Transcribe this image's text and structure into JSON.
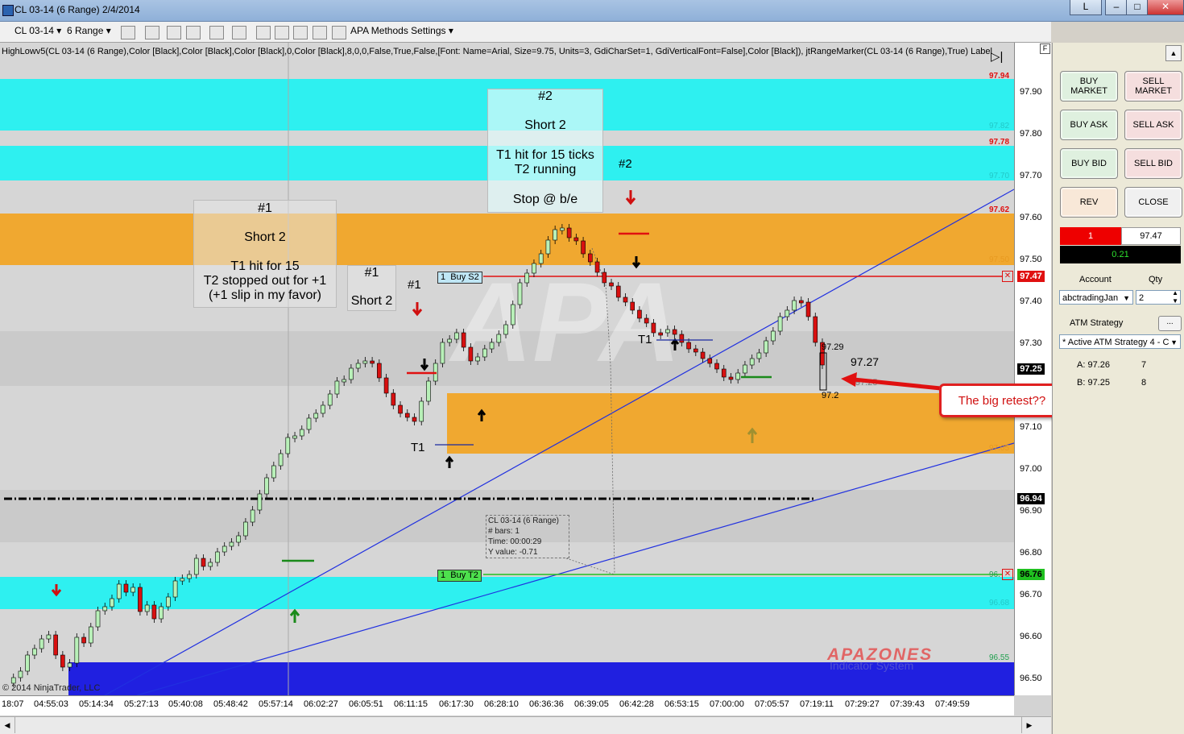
{
  "window": {
    "title": "CL 03-14 (6 Range)  2/4/2014",
    "btn_l": "L"
  },
  "toolbar": {
    "instrument": "CL 03-14",
    "period": "6 Range",
    "apa_settings": "APA Methods Settings"
  },
  "chart": {
    "indicator_text": "HighLowv5(CL 03-14 (6 Range),Color [Black],Color [Black],Color [Black],0,Color [Black],8,0,0,False,True,False,[Font: Name=Arial, Size=9.75, Units=3, GdiCharSet=1, GdiVerticalFont=False],Color [Black]), jtRangeMarker(CL 03-14 (6 Range),True) Label",
    "f_button": "F",
    "copyright": "© 2014 NinjaTrader, LLC",
    "watermark_brand": "APAZONES",
    "watermark_sub": "Indicator System",
    "y_ticks": [
      "97.90",
      "97.80",
      "97.70",
      "97.60",
      "97.50",
      "97.40",
      "97.30",
      "97.10",
      "97.00",
      "96.90",
      "96.80",
      "96.70",
      "96.60",
      "96.50"
    ],
    "zone_labels": [
      {
        "text": "97.94",
        "color": "#e01010"
      },
      {
        "text": "97.82",
        "color": "#22c8c8"
      },
      {
        "text": "97.78",
        "color": "#e01010"
      },
      {
        "text": "97.70",
        "color": "#22c8c8"
      },
      {
        "text": "97.62",
        "color": "#e01010"
      },
      {
        "text": "97.50",
        "color": "#e89a20"
      },
      {
        "text": "97.05",
        "color": "#e89a20"
      },
      {
        "text": "96.68",
        "color": "#22c8c8"
      },
      {
        "text": "96.55",
        "color": "#22a050"
      },
      {
        "text": "96.",
        "color": "#22a050"
      }
    ],
    "price_tags": {
      "sell_line": "97.47",
      "last": "97.25",
      "avg": "96.94",
      "buy_line": "96.76"
    },
    "x_ticks": [
      "18:07",
      "04:55:03",
      "05:14:34",
      "05:27:13",
      "05:40:08",
      "05:48:42",
      "05:57:14",
      "06:02:27",
      "06:05:51",
      "06:11:15",
      "06:17:30",
      "06:28:10",
      "06:36:36",
      "06:39:05",
      "06:42:28",
      "06:53:15",
      "07:00:00",
      "07:05:57",
      "07:19:11",
      "07:29:27",
      "07:39:43",
      "07:49:59"
    ],
    "orders": {
      "sell_qty": "1",
      "sell_label": "Buy S2",
      "buy_qty": "1",
      "buy_label": "Buy T2"
    },
    "bar_labels": {
      "high": "97.29",
      "low": "97.2",
      "current": "97.27",
      "last_hidden": "97.25"
    },
    "tooltip": [
      "CL 03-14 (6 Range)",
      "# bars:    1",
      "Time:      00:00:29",
      "Y value: -0.71"
    ]
  },
  "annotations": {
    "note1": {
      "title": "#1",
      "line1": "Short 2",
      "line2": "T1 hit for 15",
      "line3": "T2 stopped out for +1",
      "line4": "(+1 slip in my favor)"
    },
    "note1b": {
      "title": "#1",
      "line1": "Short 2"
    },
    "note2": {
      "title": "#2",
      "line1": "Short 2",
      "line2": "T1 hit for 15 ticks",
      "line3": "T2 running",
      "line4": "Stop @ b/e"
    },
    "label_1": "#1",
    "label_2": "#2",
    "t1_a": "T1",
    "t1_b": "T1",
    "callout": "The big retest??"
  },
  "panel": {
    "buy_market": "BUY MARKET",
    "sell_market": "SELL MARKET",
    "buy_ask": "BUY ASK",
    "sell_ask": "SELL ASK",
    "buy_bid": "BUY BID",
    "sell_bid": "SELL BID",
    "rev": "REV",
    "close": "CLOSE",
    "position_qty": "1",
    "position_price": "97.47",
    "pnl": "0.21",
    "account_label": "Account",
    "qty_label": "Qty",
    "account_value": "abctradingJan",
    "qty_value": "2",
    "atm_label": "ATM Strategy",
    "atm_value": "* Active ATM Strategy 4 - C",
    "ask_label": "A: 97.26",
    "ask_size": "7",
    "bid_label": "B: 97.25",
    "bid_size": "8"
  }
}
